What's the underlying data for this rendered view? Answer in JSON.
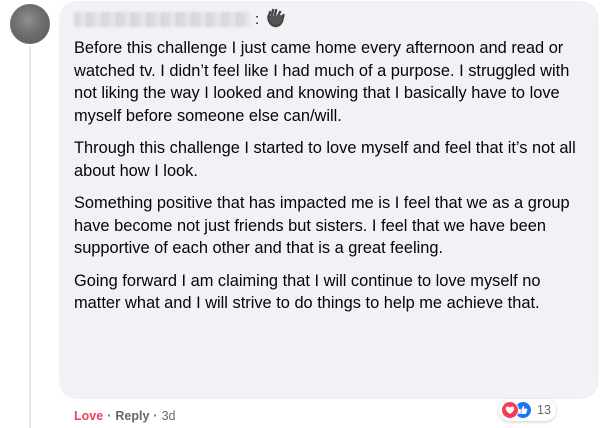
{
  "comment": {
    "colon": ":",
    "paragraphs": [
      "Before this challenge I just came home every afternoon and read or watched tv. I didn’t feel like I had much of a purpose. I struggled with not liking the way I looked and knowing that I basically have to love myself before someone else can/will.",
      "Through this challenge I started to love myself and feel that it’s not all about how I look.",
      "Something positive that has impacted me is I feel that we as a group have become not just friends but sisters. I feel that we have been supportive of each other and that is a great feeling.",
      "Going forward I am claiming that I will continue to love myself no matter what and I will strive to do things to help me achieve that."
    ],
    "reactions": {
      "icons": [
        "heart-icon",
        "thumbs-up-icon"
      ],
      "count": "13"
    },
    "actions": {
      "love_label": "Love",
      "separator": "·",
      "reply_label": "Reply",
      "timestamp": "3d"
    }
  },
  "colors": {
    "bubble": "#f0f2f5",
    "love": "#f33e58",
    "like": "#1877f2",
    "secondary_text": "#65676b"
  }
}
